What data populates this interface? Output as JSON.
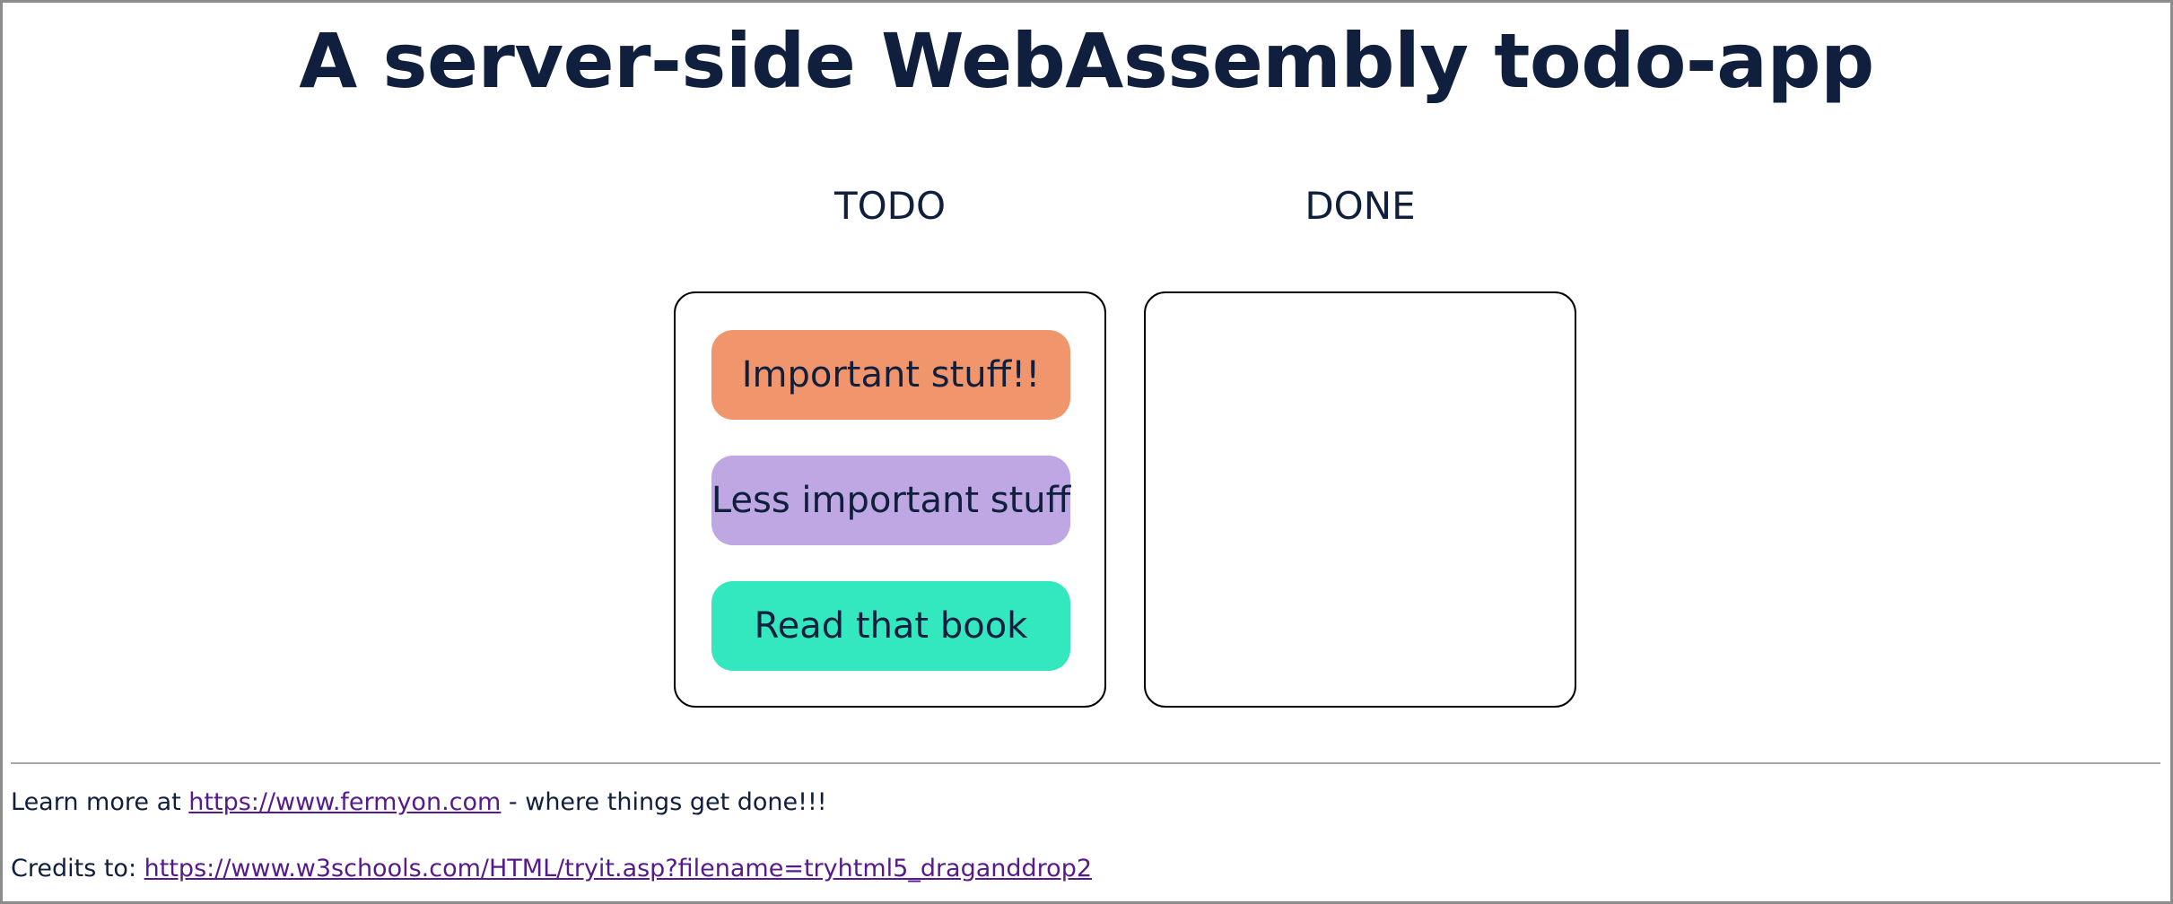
{
  "title": "A server-side WebAssembly todo-app",
  "columns": {
    "todo": {
      "heading": "TODO",
      "items": [
        {
          "label": "Important stuff!!",
          "color": "#f1956d"
        },
        {
          "label": "Less important stuff",
          "color": "#bea7e3"
        },
        {
          "label": "Read that book",
          "color": "#33e8bf"
        }
      ]
    },
    "done": {
      "heading": "DONE",
      "items": []
    }
  },
  "footer": {
    "learn_prefix": "Learn more at ",
    "learn_link": "https://www.fermyon.com",
    "learn_suffix": " - where things get done!!!",
    "credits_prefix": "Credits to: ",
    "credits_link": "https://www.w3schools.com/HTML/tryit.asp?filename=tryhtml5_draganddrop2"
  },
  "colors": {
    "text": "#0f1f3d",
    "link": "#551a8b",
    "border": "#000000"
  }
}
